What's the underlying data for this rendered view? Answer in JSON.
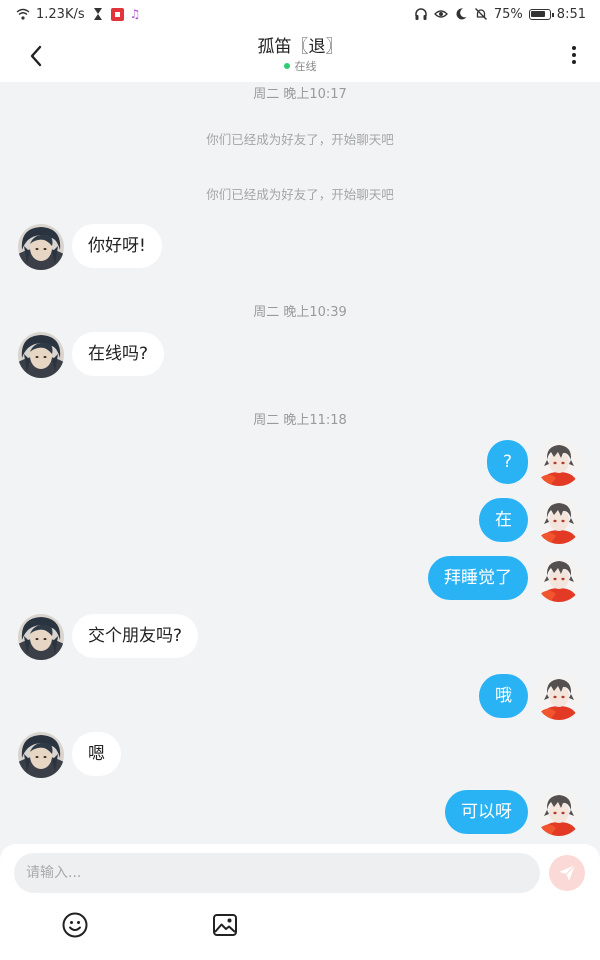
{
  "status_bar": {
    "speed": "1.23K/s",
    "battery": "75%",
    "time": "8:51"
  },
  "header": {
    "title": "孤笛〖退〗",
    "status": "在线"
  },
  "messages": {
    "ts1": "周二 晚上10:17",
    "sys1": "你们已经成为好友了，开始聊天吧",
    "sys2": "你们已经成为好友了，开始聊天吧",
    "m1": "你好呀!",
    "ts2": "周二 晚上10:39",
    "m2": "在线吗?",
    "ts3": "周二 晚上11:18",
    "m3": "?",
    "m4": "在",
    "m5": "拜睡觉了",
    "m6": "交个朋友吗?",
    "m7": "哦",
    "m8": "嗯",
    "m9": "可以呀"
  },
  "composer": {
    "placeholder": "请输入..."
  },
  "colors": {
    "outgoing_bubble": "#29b3f5",
    "incoming_bubble": "#ffffff",
    "online_dot": "#2ecc71",
    "send_button": "#fbd9d6"
  }
}
